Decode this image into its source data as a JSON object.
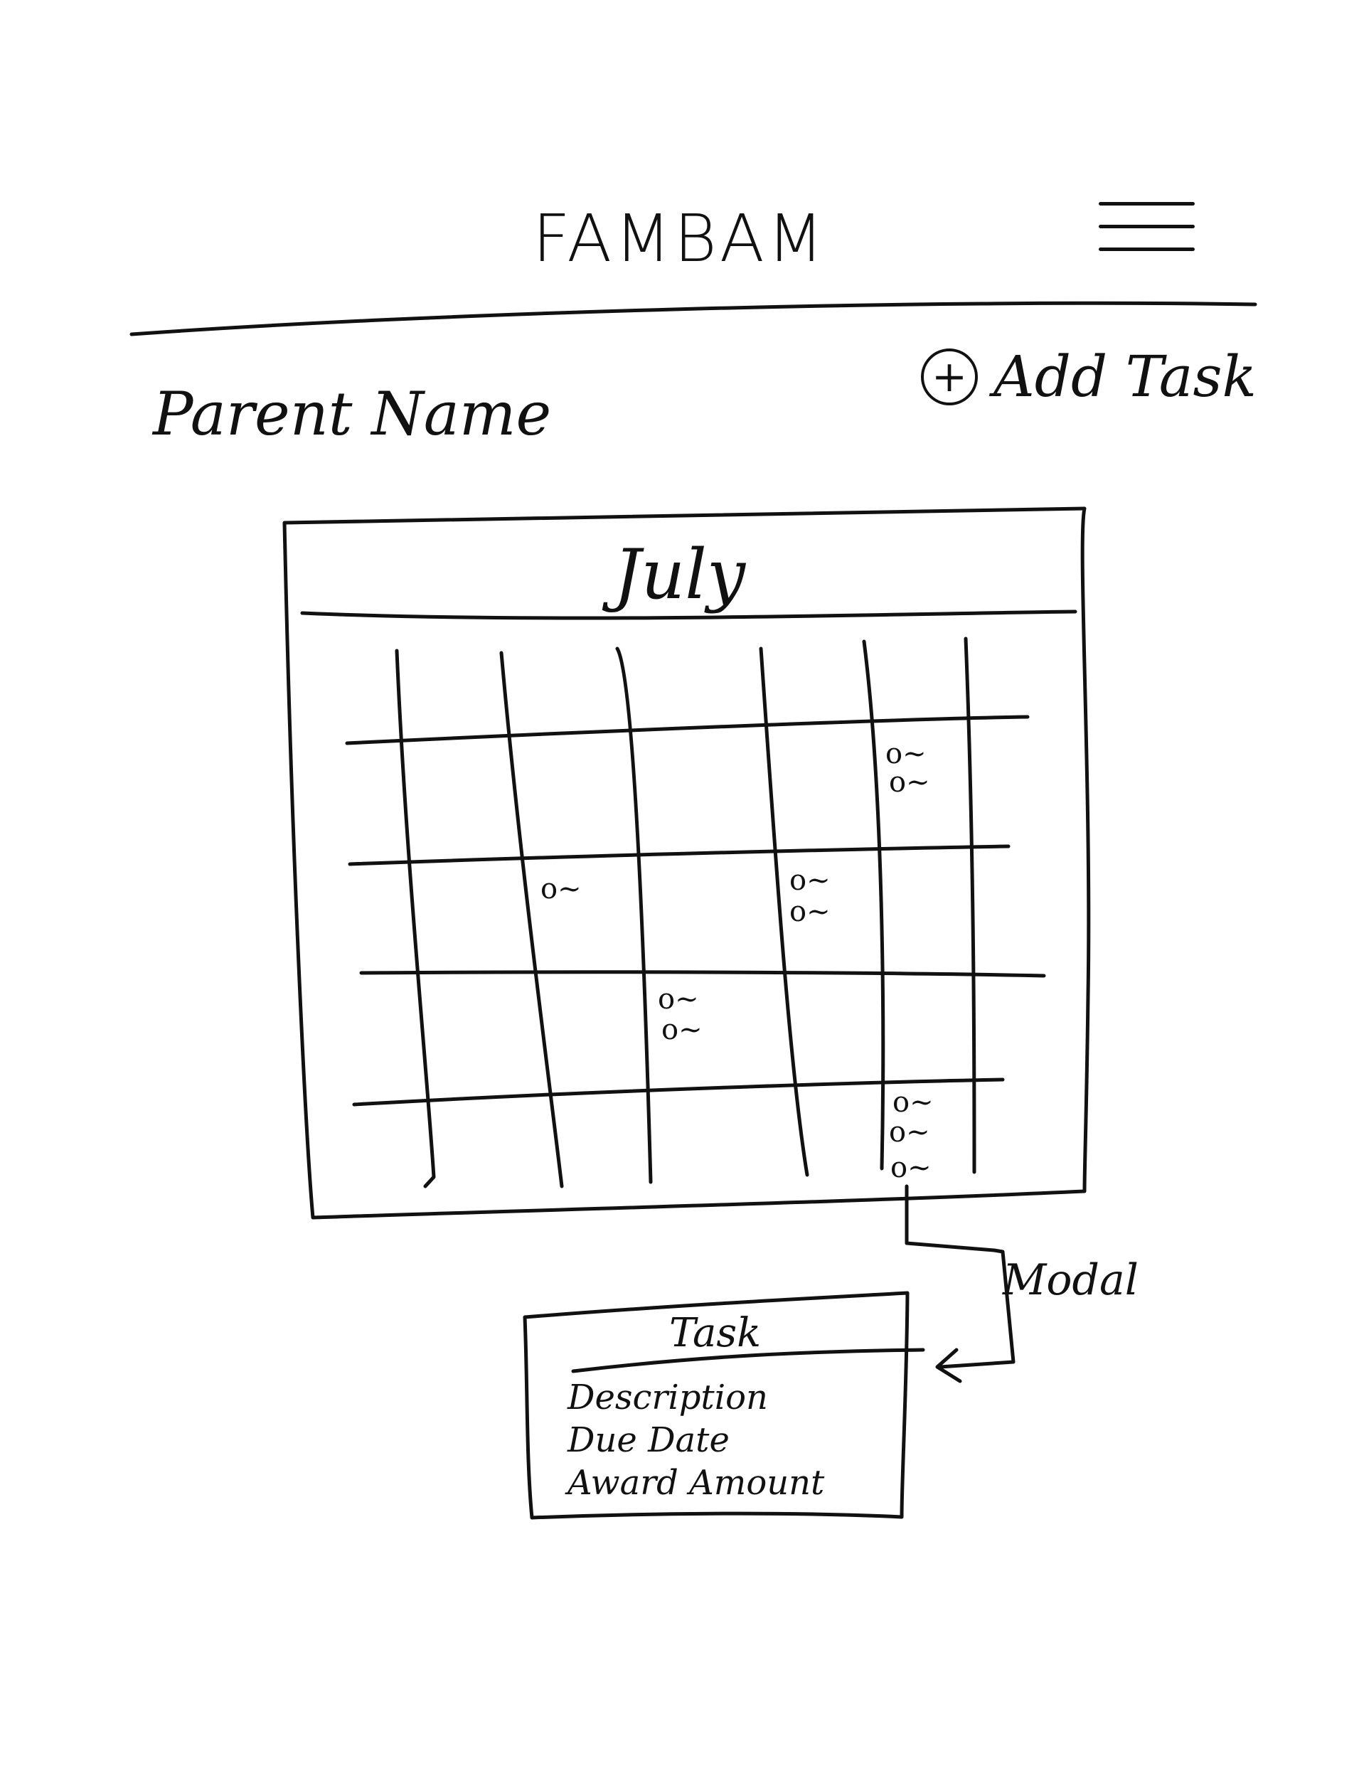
{
  "header": {
    "title": "FAMBAM",
    "menu_icon": "hamburger-menu-icon"
  },
  "subheader": {
    "parent_name": "Parent Name",
    "add_task_label": "Add Task",
    "add_task_icon": "plus-circle-icon",
    "add_task_icon_glyph": "+"
  },
  "calendar": {
    "month": "July",
    "task_marker_text": "o~"
  },
  "annotation": {
    "modal_label": "Modal"
  },
  "modal": {
    "title": "Task",
    "fields": [
      "Description",
      "Due Date",
      "Award Amount"
    ]
  }
}
